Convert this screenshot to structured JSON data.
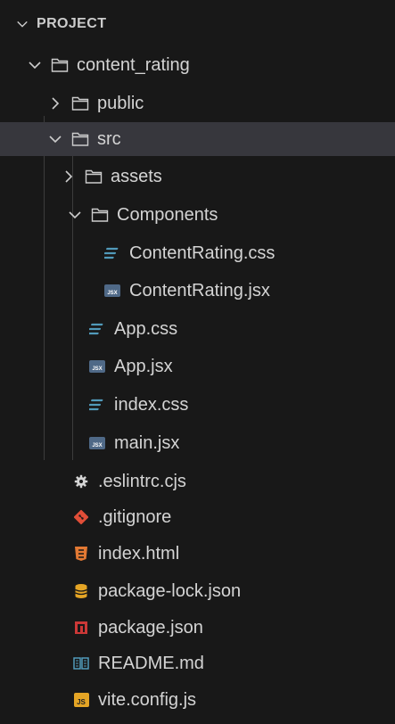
{
  "explorer": {
    "section_title": "PROJECT",
    "colors": {
      "background": "#181818",
      "selected_row": "#37373d",
      "css_icon": "#519aba",
      "jsx_icon": "#4f6987",
      "git_icon": "#e14e38",
      "html_icon": "#e37933",
      "json_lock_icon": "#e5a525",
      "package_icon": "#cb3837",
      "readme_icon": "#519aba",
      "js_icon": "#e5a525"
    },
    "tree": [
      {
        "label": "content_rating",
        "icon": "folder-icon",
        "chevron": "chevron-down-icon"
      },
      {
        "label": "public",
        "icon": "folder-icon",
        "chevron": "chevron-right-icon"
      },
      {
        "label": "src",
        "icon": "folder-icon",
        "chevron": "chevron-down-icon",
        "selected": true
      },
      {
        "label": "assets",
        "icon": "folder-icon",
        "chevron": "chevron-right-icon"
      },
      {
        "label": "Components",
        "icon": "folder-icon",
        "chevron": "chevron-down-icon"
      },
      {
        "label": "ContentRating.css",
        "icon": "css-file-icon"
      },
      {
        "label": "ContentRating.jsx",
        "icon": "jsx-file-icon"
      },
      {
        "label": "App.css",
        "icon": "css-file-icon"
      },
      {
        "label": "App.jsx",
        "icon": "jsx-file-icon"
      },
      {
        "label": "index.css",
        "icon": "css-file-icon"
      },
      {
        "label": "main.jsx",
        "icon": "jsx-file-icon"
      },
      {
        "label": ".eslintrc.cjs",
        "icon": "gear-icon"
      },
      {
        "label": ".gitignore",
        "icon": "git-icon"
      },
      {
        "label": "index.html",
        "icon": "html-file-icon"
      },
      {
        "label": "package-lock.json",
        "icon": "database-icon"
      },
      {
        "label": "package.json",
        "icon": "npm-package-icon"
      },
      {
        "label": "README.md",
        "icon": "readme-icon"
      },
      {
        "label": "vite.config.js",
        "icon": "js-file-icon"
      }
    ],
    "badges": {
      "jsx": "JSX",
      "js": "JS"
    }
  }
}
